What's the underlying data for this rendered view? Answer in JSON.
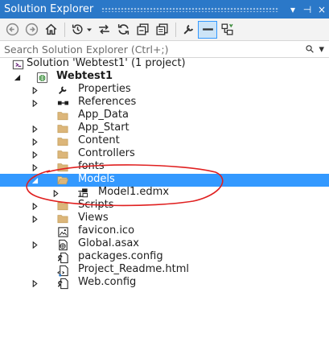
{
  "window": {
    "title": "Solution Explorer",
    "pin_glyph": "▾",
    "autohide_glyph": "⊣",
    "close_glyph": "×"
  },
  "toolbar": {
    "icons": [
      "back-icon",
      "forward-icon",
      "home-icon",
      "history-icon",
      "sync-icon",
      "refresh-icon",
      "collapse-all-icon",
      "copy-icon",
      "properties-icon",
      "show-all-files-icon",
      "view-class-diagram-icon"
    ]
  },
  "search": {
    "placeholder": "Search Solution Explorer (Ctrl+;)",
    "search_glyph": "⚲",
    "dropdown_glyph": "▾"
  },
  "tree": {
    "solution": "Solution 'Webtest1' (1 project)",
    "project": "Webtest1",
    "items": [
      {
        "label": "Properties",
        "icon": "wrench-icon"
      },
      {
        "label": "References",
        "icon": "references-icon"
      },
      {
        "label": "App_Data",
        "icon": "folder-icon"
      },
      {
        "label": "App_Start",
        "icon": "folder-icon"
      },
      {
        "label": "Content",
        "icon": "folder-icon"
      },
      {
        "label": "Controllers",
        "icon": "folder-icon"
      },
      {
        "label": "fonts",
        "icon": "folder-icon"
      },
      {
        "label": "Models",
        "icon": "folder-open-icon",
        "selected": true
      },
      {
        "label": "Model1.edmx",
        "icon": "edmx-icon"
      },
      {
        "label": "Scripts",
        "icon": "folder-icon"
      },
      {
        "label": "Views",
        "icon": "folder-icon"
      },
      {
        "label": "favicon.ico",
        "icon": "image-file-icon"
      },
      {
        "label": "Global.asax",
        "icon": "global-asax-icon"
      },
      {
        "label": "packages.config",
        "icon": "config-file-icon"
      },
      {
        "label": "Project_Readme.html",
        "icon": "html-file-icon"
      },
      {
        "label": "Web.config",
        "icon": "config-file-icon"
      }
    ]
  },
  "colors": {
    "title_bar": "#2b78c8",
    "selection": "#3399ff",
    "folder": "#dcb67a",
    "annotation": "#e02020"
  }
}
